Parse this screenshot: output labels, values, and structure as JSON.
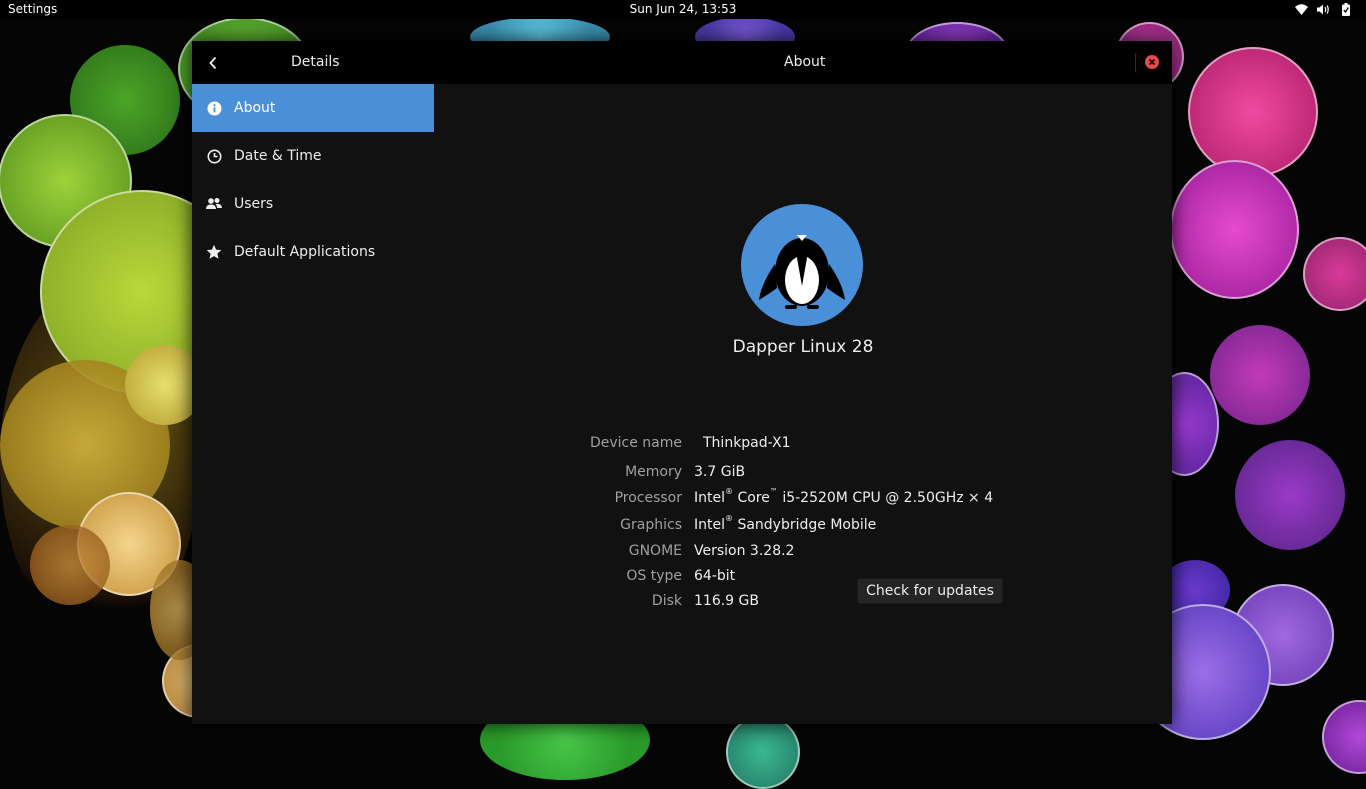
{
  "topbar": {
    "app_name": "Settings",
    "clock": "Sun Jun 24, 13:53",
    "tray_icons": [
      "wifi-icon",
      "volume-icon",
      "battery-icon"
    ]
  },
  "window": {
    "back_icon": "chevron-left-icon",
    "sidebar_title": "Details",
    "content_title": "About",
    "close_icon": "close-icon"
  },
  "sidebar": {
    "items": [
      {
        "label": "About",
        "icon": "info-icon",
        "active": true
      },
      {
        "label": "Date & Time",
        "icon": "clock-icon",
        "active": false
      },
      {
        "label": "Users",
        "icon": "users-icon",
        "active": false
      },
      {
        "label": "Default Applications",
        "icon": "star-icon",
        "active": false
      }
    ]
  },
  "about": {
    "logo_icon": "penguin-logo-icon",
    "distro_name": "Dapper Linux 28",
    "device_name_label": "Device name",
    "device_name_value": "Thinkpad-X1",
    "memory_label": "Memory",
    "memory_value": "3.7 GiB",
    "processor_label": "Processor",
    "processor_brand": "Intel",
    "processor_line": "Core",
    "processor_rest": "i5-2520M CPU @ 2.50GHz × 4",
    "processor_reg": "®",
    "processor_tm": "™",
    "graphics_label": "Graphics",
    "graphics_brand": "Intel",
    "graphics_reg": "®",
    "graphics_rest": "Sandybridge Mobile",
    "gnome_label": "GNOME",
    "gnome_value": "Version 3.28.2",
    "os_type_label": "OS type",
    "os_type_value": "64-bit",
    "disk_label": "Disk",
    "disk_value": "116.9 GB",
    "update_button": "Check for updates"
  },
  "colors": {
    "accent": "#4a90d9",
    "window_bg": "#111111",
    "headerbar_bg": "#000000",
    "close_button": "#e34c4c"
  }
}
